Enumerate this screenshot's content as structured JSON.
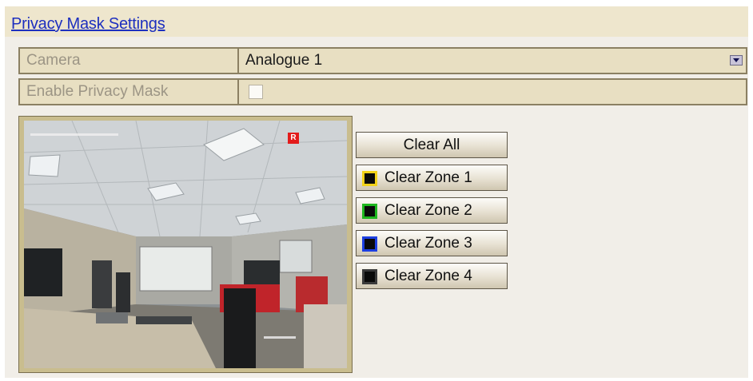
{
  "header": {
    "title": "Privacy Mask Settings"
  },
  "camera": {
    "label": "Camera",
    "value": "Analogue 1"
  },
  "enable": {
    "label": "Enable Privacy Mask",
    "checked": false
  },
  "preview": {
    "rec_badge": "R"
  },
  "buttons": {
    "clear_all": "Clear All",
    "zones": [
      {
        "label": "Clear Zone 1",
        "color": "#f2d21a"
      },
      {
        "label": "Clear Zone 2",
        "color": "#1fb71f"
      },
      {
        "label": "Clear Zone 3",
        "color": "#1d3fe0"
      },
      {
        "label": "Clear Zone 4",
        "color": "#3a3a3a"
      }
    ]
  },
  "icons": {
    "dropdown": "chevron-down-icon"
  }
}
